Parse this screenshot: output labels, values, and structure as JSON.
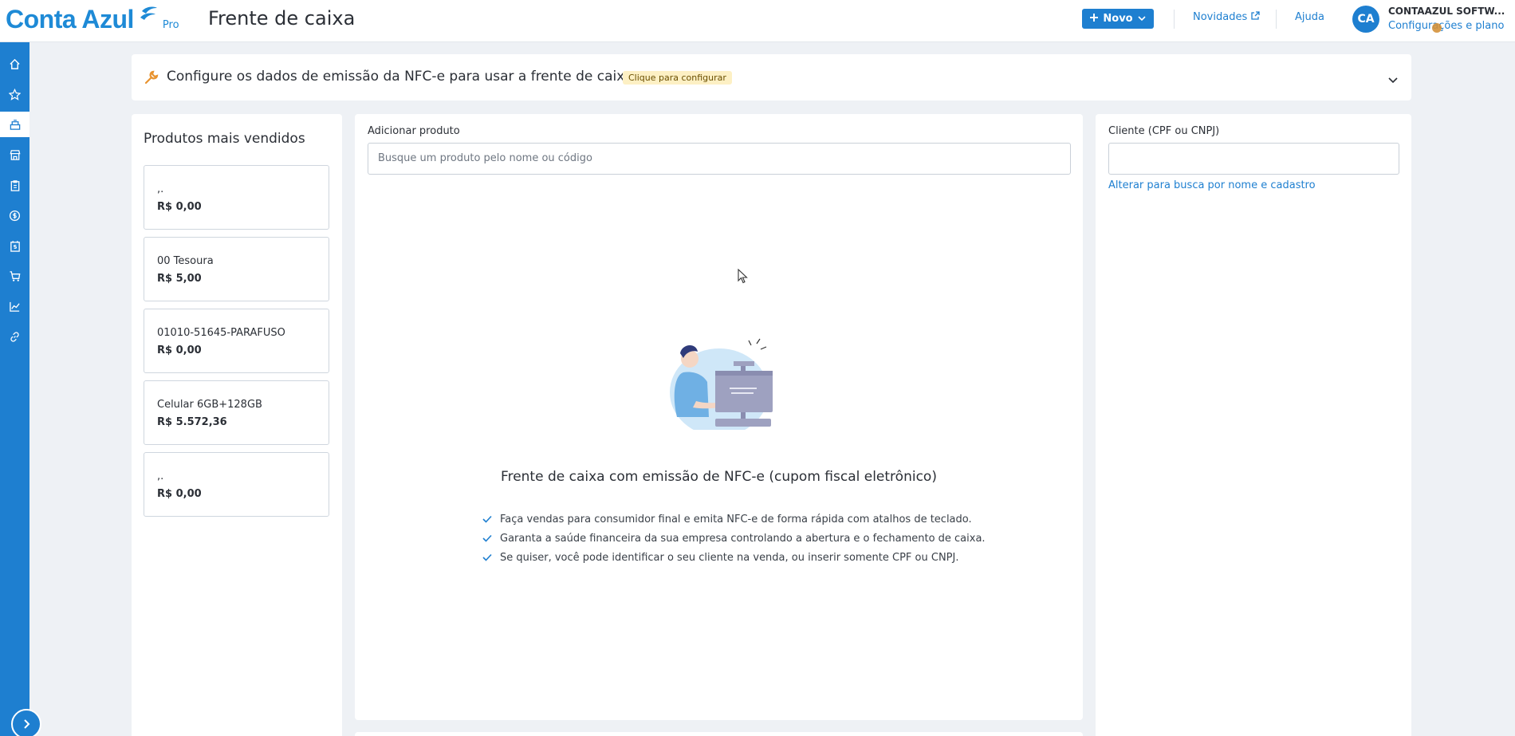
{
  "header": {
    "logo_text": "Conta Azul",
    "logo_tier": "Pro",
    "page_title": "Frente de caixa",
    "novo_label": "Novo",
    "novidades_label": "Novidades",
    "ajuda_label": "Ajuda",
    "avatar_initials": "CA",
    "company_name": "CONTAAZUL SOFTW...",
    "config_link": "Configurações e plano"
  },
  "sidebar": {
    "items": [
      "home-icon",
      "star-icon",
      "cash-register-icon",
      "store-icon",
      "clipboard-icon",
      "dollar-icon",
      "calendar-dollar-icon",
      "cart-icon",
      "chart-icon",
      "link-icon"
    ],
    "active_index": 2
  },
  "banner": {
    "text": "Configure os dados de emissão da NFC-e para usar a frente de caixa",
    "badge": "Clique para configurar"
  },
  "best_sellers": {
    "title": "Produtos mais vendidos",
    "products": [
      {
        "name": ",.",
        "price": "R$ 0,00"
      },
      {
        "name": "00 Tesoura",
        "price": "R$ 5,00"
      },
      {
        "name": "01010-51645-PARAFUSO",
        "price": "R$ 0,00"
      },
      {
        "name": "Celular 6GB+128GB",
        "price": "R$ 5.572,36"
      },
      {
        "name": ",.",
        "price": "R$ 0,00"
      }
    ]
  },
  "center": {
    "add_label": "Adicionar produto",
    "search_placeholder": "Busque um produto pelo nome ou código",
    "empty_title": "Frente de caixa com emissão de NFC-e (cupom fiscal eletrônico)",
    "bullets": [
      "Faça vendas para consumidor final e emita NFC-e de forma rápida com atalhos de teclado.",
      "Garanta a saúde financeira da sua empresa controlando a abertura e o fechamento de caixa.",
      "Se quiser, você pode identificar o seu cliente na venda, ou inserir somente CPF ou CNPJ."
    ]
  },
  "customer": {
    "label": "Cliente (CPF ou CNPJ)",
    "input_value": "",
    "switch_link": "Alterar para busca por nome e cadastro"
  },
  "colors": {
    "brand": "#1e7fd0",
    "badge_bg": "#fdf0c4",
    "page_bg": "#eef1f5"
  }
}
